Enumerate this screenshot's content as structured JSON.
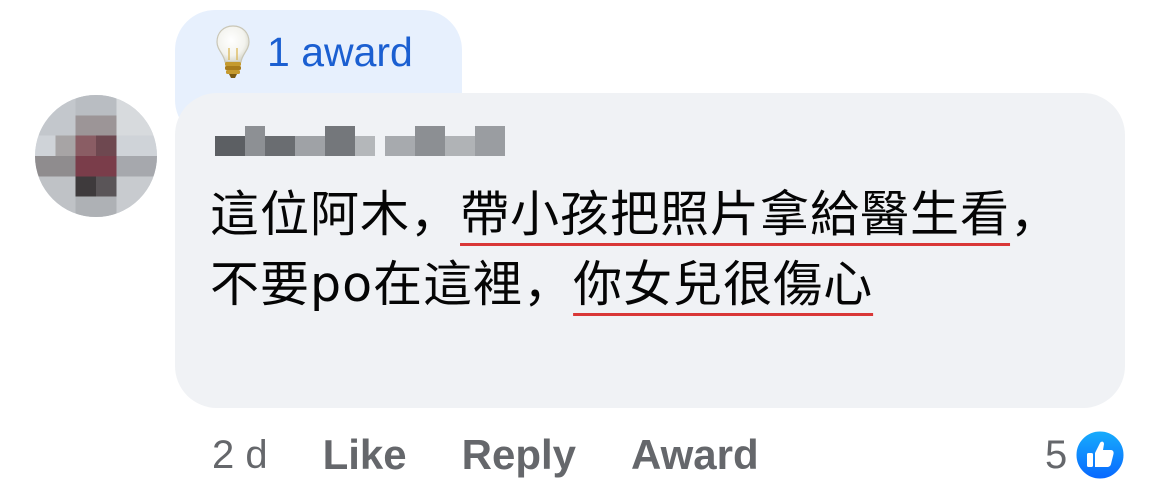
{
  "award": {
    "label": "1 award",
    "icon": "lightbulb-icon"
  },
  "comment": {
    "author_name": "(blurred)",
    "text_segments": [
      {
        "text": "這位阿木，",
        "underlined": false
      },
      {
        "text": "帶小孩把照片拿給醫生看",
        "underlined": true
      },
      {
        "text": "，不要po在這裡，",
        "underlined": false
      },
      {
        "text": "你女兒很傷心",
        "underlined": true
      }
    ],
    "underline_color": "#d93737"
  },
  "actions": {
    "time": "2 d",
    "like": "Like",
    "reply": "Reply",
    "award": "Award"
  },
  "reactions": {
    "count": "5",
    "icon": "thumbs-up-icon",
    "color": "#1877f2"
  },
  "colors": {
    "bubble_bg": "#f0f2f5",
    "award_bg": "#e7f0fd",
    "award_text": "#1b5fd1",
    "secondary_text": "#65676b"
  }
}
